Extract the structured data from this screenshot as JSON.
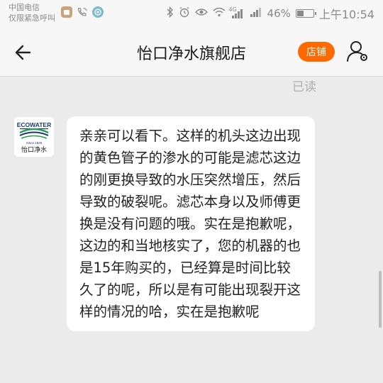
{
  "status_bar": {
    "carrier_line1": "中国电信",
    "carrier_line2": "仅限紧急呼叫",
    "network": "4G",
    "battery_percent": "46%",
    "battery_level": 0.46,
    "time": "上午10:54"
  },
  "nav": {
    "title": "怡口净水旗舰店",
    "shop_label": "店铺",
    "accent_color": "#ff6a00"
  },
  "chat": {
    "read_status": "已读",
    "avatar_brand": "ECOWATER",
    "avatar_since": "Since 1925",
    "avatar_name": "怡口净水",
    "message": "亲亲可以看下。这样的机头这边出现的黄色管子的渗水的可能是滤芯这边的刚更换导致的水压突然增压，然后导致的破裂呢。滤芯本身以及师傅更换是没有问题的哦。实在是抱歉呢，这边的和当地核实了，您的机器的也是15年购买的，已经算是时间比较久了的呢，所以是有可能出现裂开这样的情况的哈，实在是抱歉呢"
  }
}
